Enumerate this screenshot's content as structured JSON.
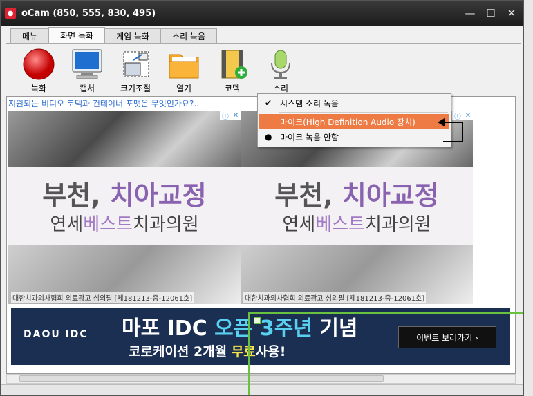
{
  "window": {
    "title": "oCam (850, 555, 830, 495)",
    "minimize_glyph": "—",
    "maximize_glyph": "☐",
    "close_glyph": "✕"
  },
  "tabs": [
    {
      "label": "메뉴"
    },
    {
      "label": "화면 녹화"
    },
    {
      "label": "게임 녹화"
    },
    {
      "label": "소리 녹음"
    }
  ],
  "toolbar": {
    "record": {
      "label": "녹화",
      "icon": "record-icon"
    },
    "capture": {
      "label": "캡처",
      "icon": "monitor-icon"
    },
    "resize": {
      "label": "크기조절",
      "icon": "resize-icon"
    },
    "open": {
      "label": "열기",
      "icon": "folder-icon"
    },
    "codec": {
      "label": "코덱",
      "icon": "film-add-icon"
    },
    "sound": {
      "label": "소리",
      "icon": "microphone-icon"
    }
  },
  "sound_menu": {
    "items": [
      {
        "label": "시스템 소리 녹음",
        "mark": "✔",
        "state": "checked"
      },
      {
        "label": "마이크(High Definition Audio 장치)",
        "mark": "",
        "state": "highlighted"
      },
      {
        "label": "마이크 녹음 안함",
        "mark": "●",
        "state": "selected"
      }
    ]
  },
  "page": {
    "question_link": "지원되는 비디오 코덱과 컨테이너 포맷은 무엇인가요?..",
    "ads": [
      {
        "headline_a": "부천, ",
        "headline_b": "치아교정",
        "sub_a": "연세",
        "sub_b": "베스트",
        "sub_c": "치과의원",
        "fine": "대한치과의사협회 의료광고 심의필 [제181213-중-12061호]",
        "badge_i": "ⓘ",
        "badge_x": "✕"
      },
      {
        "headline_a": "부천, ",
        "headline_b": "치아교정",
        "sub_a": "연세",
        "sub_b": "베스트",
        "sub_c": "치과의원",
        "fine": "대한치과의사협회 의료광고 심의필 [제181213-중-12061호]",
        "badge_i": "ⓘ",
        "badge_x": "✕"
      }
    ],
    "banner": {
      "brand": "DAOU IDC",
      "headline_a": "마포 IDC ",
      "headline_b": "오픈 3주년",
      "headline_c": " 기념",
      "sub_a": "코로케이션 2개월 ",
      "sub_b": "무료",
      "sub_c": "사용!",
      "button": "이벤트 보러가기  ›"
    }
  },
  "colors": {
    "menu_highlight": "#ee7a44",
    "selection_frame": "#69c23d",
    "link": "#2f6fd0"
  }
}
